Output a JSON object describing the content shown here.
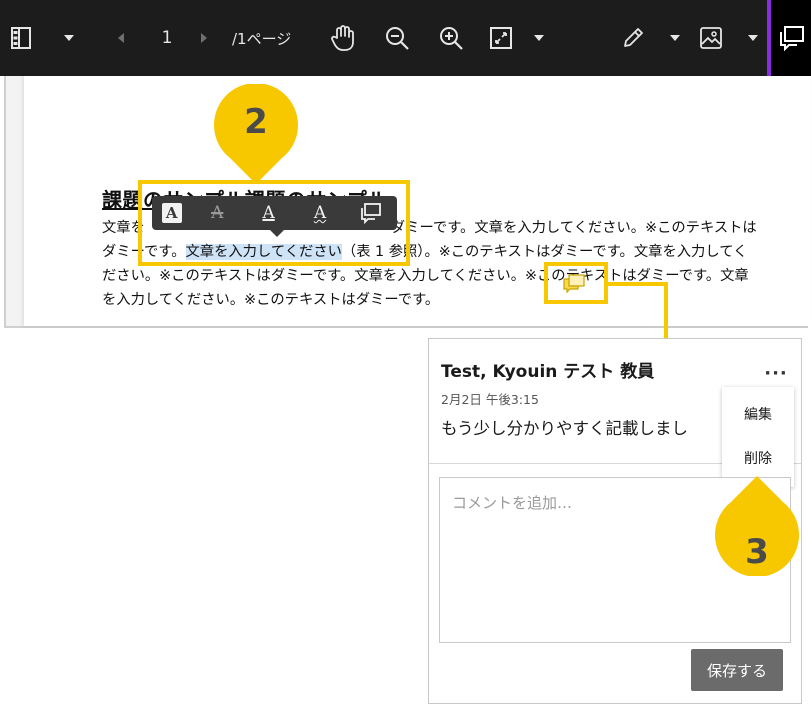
{
  "toolbar": {
    "page_number": "1",
    "page_total": "/1ページ",
    "icons": [
      "sidebar-toggle-icon",
      "chevron-down-icon",
      "chevron-left-icon",
      "chevron-right-icon",
      "pan-hand-icon",
      "zoom-out-icon",
      "zoom-in-icon",
      "fit-page-icon",
      "chevron-down-icon",
      "pencil-icon",
      "chevron-down-icon",
      "image-stamp-icon",
      "chevron-down-icon",
      "comment-icon"
    ]
  },
  "document": {
    "title": "課題のサンプル課題のサンプル",
    "line1_start": "文章を",
    "line1_end": "ダミーです。文章を入力してください。※このテキストは",
    "line2_start": "ダミーです。",
    "line2_highlight": "文章を入力してください",
    "line2_end": "（表 1 参照）。※このテキストはダミーです。文章を入力してく",
    "line3": "ださい。※このテキストはダミーです。文章を入力してください。※このテキストはダミーです。文章",
    "line4": "を入力してください。※このテキストはダミーです。"
  },
  "format_bar": {
    "highlight_label": "A",
    "strikethrough_label": "A",
    "underline_label": "A",
    "squiggly_label": "A"
  },
  "callouts": {
    "step2": "2",
    "step3": "3"
  },
  "comment": {
    "author": "Test, Kyouin テスト 教員",
    "timestamp": "2月2日 午後3:15",
    "body": "もう少し分かりやすく記載しまし",
    "more_label": "···",
    "menu_edit": "編集",
    "menu_delete": "削除",
    "input_placeholder": "コメントを追加…",
    "save_label": "保存する"
  },
  "colors": {
    "toolbar_bg": "#1c1c1c",
    "callout_yellow": "#f7c800",
    "highlight_blue": "#cfe3f7",
    "save_button": "#6b6b6b"
  }
}
